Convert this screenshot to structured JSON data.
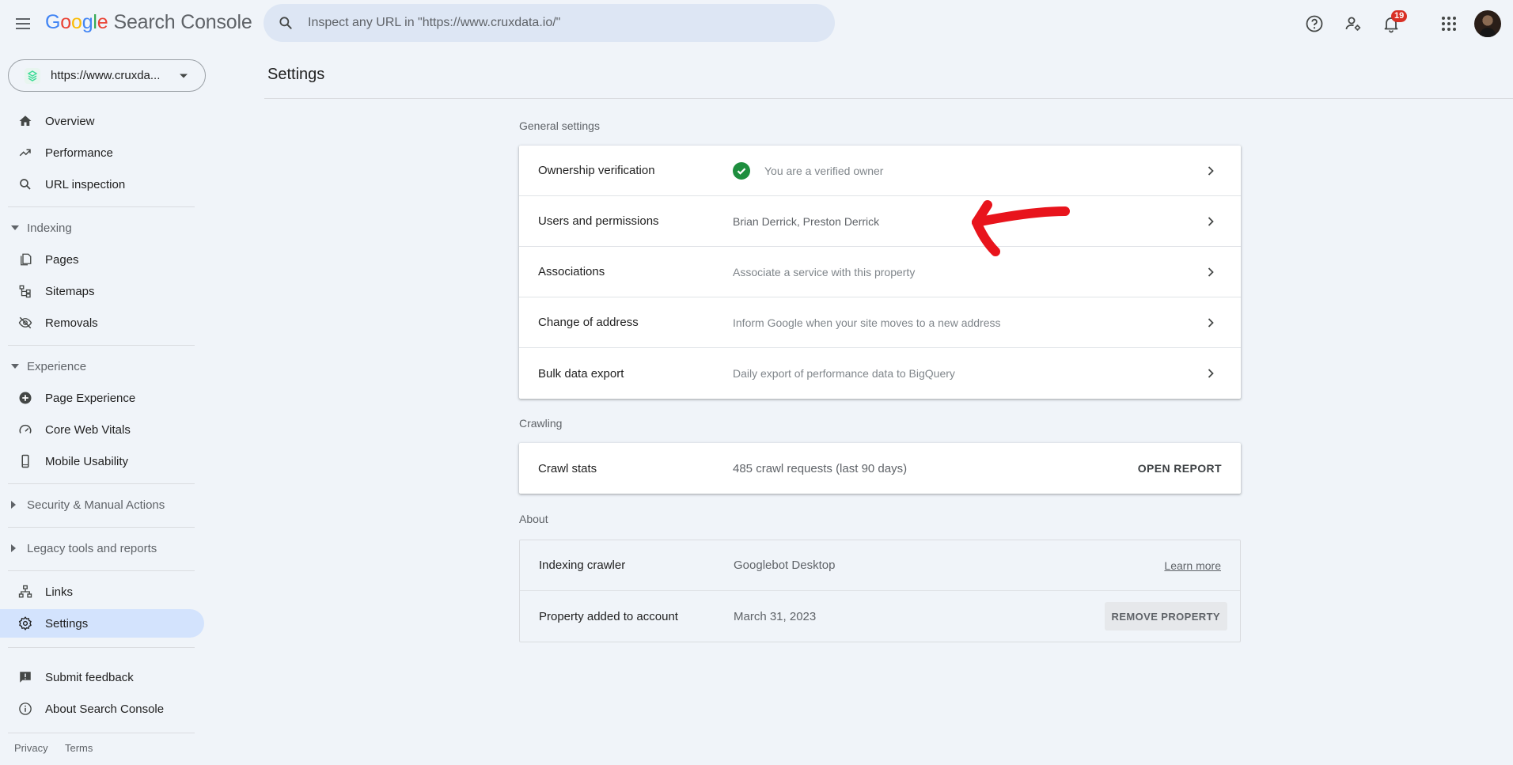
{
  "header": {
    "logo_google": [
      "G",
      "o",
      "o",
      "g",
      "l",
      "e"
    ],
    "logo_product": "Search Console",
    "search_placeholder": "Inspect any URL in \"https://www.cruxdata.io/\"",
    "notification_count": "19"
  },
  "sidebar": {
    "property": "https://www.cruxda...",
    "items_top": [
      {
        "label": "Overview",
        "icon": "home-icon"
      },
      {
        "label": "Performance",
        "icon": "trending-up-icon"
      },
      {
        "label": "URL inspection",
        "icon": "search-icon"
      }
    ],
    "sections": {
      "indexing": "Indexing",
      "experience": "Experience",
      "security": "Security & Manual Actions",
      "legacy": "Legacy tools and reports"
    },
    "indexing_items": [
      {
        "label": "Pages",
        "icon": "pages-icon"
      },
      {
        "label": "Sitemaps",
        "icon": "sitemap-icon"
      },
      {
        "label": "Removals",
        "icon": "eye-off-icon"
      }
    ],
    "experience_items": [
      {
        "label": "Page Experience",
        "icon": "plus-circle-icon"
      },
      {
        "label": "Core Web Vitals",
        "icon": "speed-icon"
      },
      {
        "label": "Mobile Usability",
        "icon": "phone-icon"
      }
    ],
    "links": "Links",
    "settings": "Settings",
    "submit_feedback": "Submit feedback",
    "about": "About Search Console",
    "privacy": "Privacy",
    "terms": "Terms"
  },
  "main": {
    "title": "Settings",
    "general_label": "General settings",
    "general_rows": [
      {
        "label": "Ownership verification",
        "value": "You are a verified owner"
      },
      {
        "label": "Users and permissions",
        "value": "Brian Derrick, Preston Derrick"
      },
      {
        "label": "Associations",
        "value": "Associate a service with this property"
      },
      {
        "label": "Change of address",
        "value": "Inform Google when your site moves to a new address"
      },
      {
        "label": "Bulk data export",
        "value": "Daily export of performance data to BigQuery"
      }
    ],
    "crawling_label": "Crawling",
    "crawl": {
      "label": "Crawl stats",
      "value": "485 crawl requests (last 90 days)",
      "action": "OPEN REPORT"
    },
    "about_label": "About",
    "about_rows": [
      {
        "label": "Indexing crawler",
        "value": "Googlebot Desktop",
        "action": "Learn more"
      },
      {
        "label": "Property added to account",
        "value": "March 31, 2023",
        "action": "REMOVE PROPERTY"
      }
    ]
  },
  "colors": {
    "background": "#f0f4f9",
    "active_nav": "#d3e3fd",
    "verified_green": "#1e8e3e",
    "badge_red": "#d93025",
    "annotation_red": "#e8141c"
  }
}
